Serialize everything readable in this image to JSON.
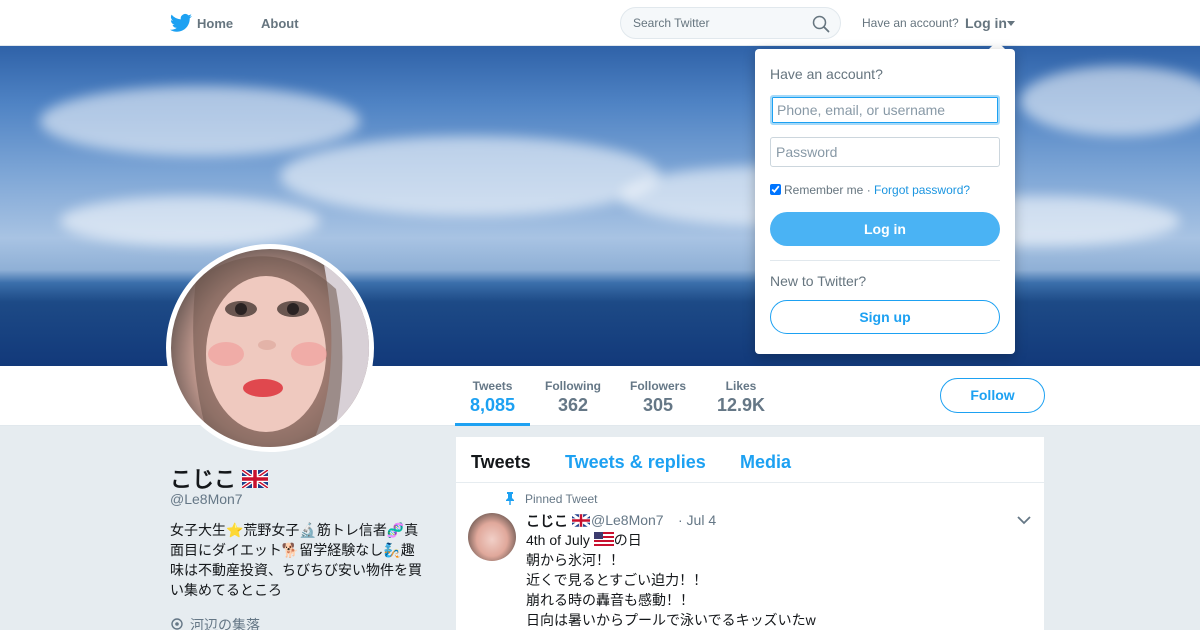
{
  "nav": {
    "home_label": "Home",
    "about_label": "About",
    "search_placeholder": "Search Twitter",
    "have_account_text": "Have an account?",
    "login_label": "Log in"
  },
  "profile_nav": {
    "stats": [
      {
        "label": "Tweets",
        "value": "8,085"
      },
      {
        "label": "Following",
        "value": "362"
      },
      {
        "label": "Followers",
        "value": "305"
      },
      {
        "label": "Likes",
        "value": "12.9K"
      }
    ],
    "follow_label": "Follow"
  },
  "profile": {
    "name": "こじこ",
    "handle": "@Le8Mon7",
    "bio_lines": [
      "女子大生⭐荒野女子🔬筋トレ信者🧬真",
      "面目にダイエット🐕留学経験なし🧞趣",
      "味は不動産投資、ちびちび安い物件を買",
      "い集めてるところ"
    ],
    "location": "河辺の集落"
  },
  "timeline": {
    "tabs": [
      "Tweets",
      "Tweets & replies",
      "Media"
    ],
    "pinned_label": "Pinned Tweet",
    "tweet": {
      "name": "こじこ",
      "handle": "@Le8Mon7",
      "date": "· Jul 4",
      "line1_pre": "4th of July",
      "line1_post": "の日",
      "lines": [
        "朝から氷河！！",
        "近くで見るとすごい迫力！！",
        "崩れる時の轟音も感動！！",
        "日向は暑いからプールで泳いでるキッズいたw"
      ]
    }
  },
  "login_dropdown": {
    "title": "Have an account?",
    "username_placeholder": "Phone, email, or username",
    "password_placeholder": "Password",
    "remember_label": "Remember me",
    "separator": "·",
    "forgot_label": "Forgot password?",
    "login_button": "Log in",
    "new_label": "New to Twitter?",
    "signup_button": "Sign up"
  },
  "colors": {
    "accent": "#1da1f2",
    "login_button_bg": "#4ab3f4",
    "page_bg": "#e6ecf0"
  }
}
